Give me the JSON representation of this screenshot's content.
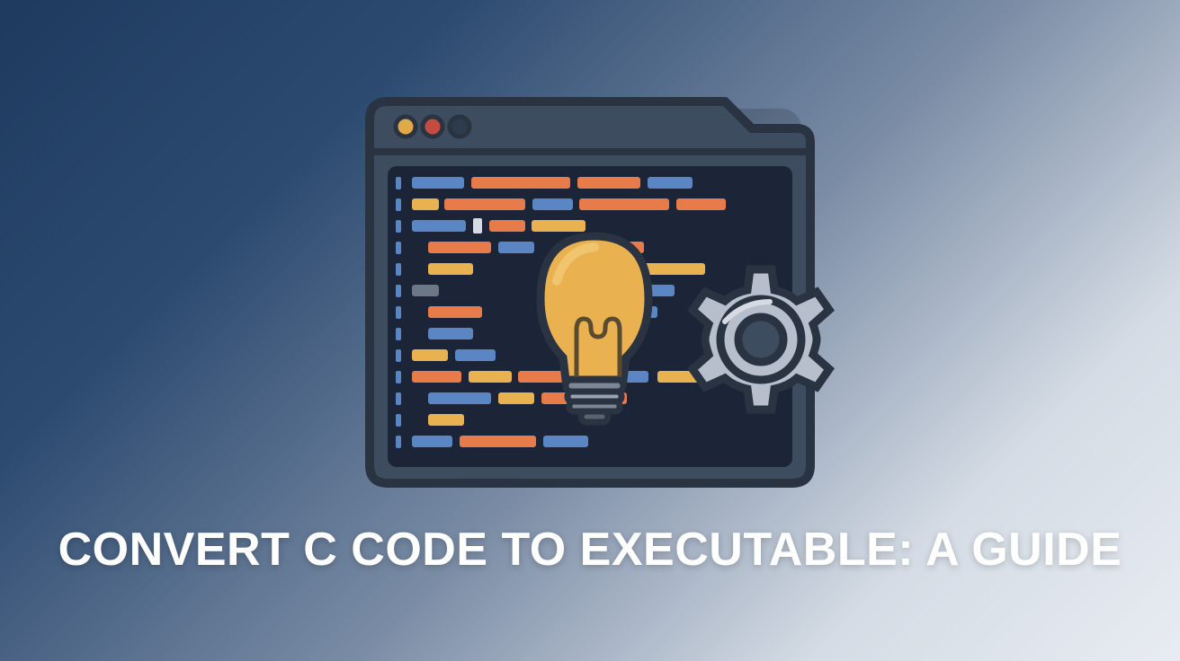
{
  "title": "CONVERT C CODE TO EXECUTABLE: A GUIDE",
  "illustration": {
    "window_frame_color": "#3e4c5f",
    "window_bg_color": "#1b2537",
    "traffic_light_colors": [
      "#e0a94a",
      "#c34b3f",
      "#2d3b4e"
    ],
    "code_colors": {
      "blue": "#5b86c4",
      "orange": "#e77b4a",
      "yellow": "#e9b14f",
      "gray": "#6d7886",
      "light": "#d6dbe3"
    },
    "lightbulb": {
      "glass": "#e9b14f",
      "glass_highlight": "#f0c56e",
      "base": "#7d8793",
      "filament": "#5a4a30"
    },
    "gear_color": "#b6bfcb",
    "gear_shadow": "#6d7886"
  }
}
